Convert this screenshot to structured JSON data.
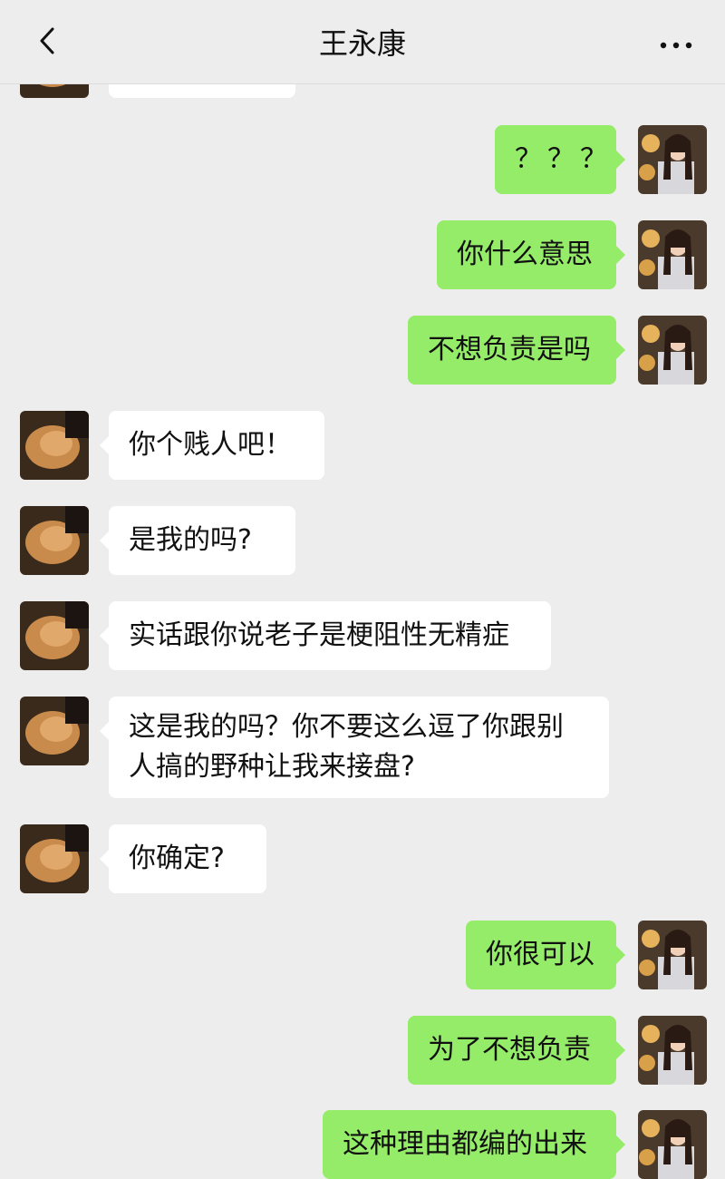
{
  "header": {
    "title": "王永康",
    "back_icon": "chevron-left-icon",
    "more_icon": "more-dots-icon"
  },
  "colors": {
    "background": "#ededed",
    "outgoing_bubble": "#95ec69",
    "incoming_bubble": "#ffffff"
  },
  "messages": [
    {
      "sender": "contact",
      "text": ""
    },
    {
      "sender": "self",
      "text": "？？？"
    },
    {
      "sender": "self",
      "text": "你什么意思"
    },
    {
      "sender": "self",
      "text": "不想负责是吗"
    },
    {
      "sender": "contact",
      "text": "你个贱人吧！"
    },
    {
      "sender": "contact",
      "text": "是我的吗?"
    },
    {
      "sender": "contact",
      "text": "实话跟你说老子是梗阻性无精症"
    },
    {
      "sender": "contact",
      "text": "这是我的吗？你不要这么逗了你跟别人搞的野种让我来接盘?"
    },
    {
      "sender": "contact",
      "text": "你确定?"
    },
    {
      "sender": "self",
      "text": "你很可以"
    },
    {
      "sender": "self",
      "text": "为了不想负责"
    },
    {
      "sender": "self",
      "text": "这种理由都编的出来"
    }
  ]
}
